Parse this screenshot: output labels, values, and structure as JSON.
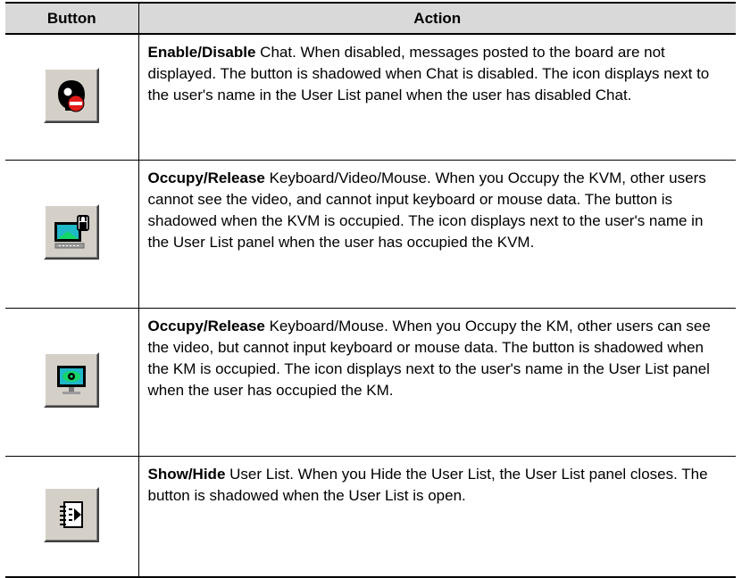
{
  "table": {
    "headers": {
      "button": "Button",
      "action": "Action"
    },
    "rows": [
      {
        "icon": "chat-disable-icon",
        "bold": "Enable/Disable",
        "text": " Chat. When disabled, messages posted to the board are not displayed. The button is shadowed when Chat is disabled. The icon displays next to the user's name in the User List panel when the user has disabled Chat."
      },
      {
        "icon": "occupy-kvm-icon",
        "bold": "Occupy/Release",
        "text": " Keyboard/Video/Mouse. When you Occupy the KVM, other users cannot see the video, and cannot input keyboard or mouse data. The button is shadowed when the KVM is occupied. The icon displays next to the user's name in the User List panel when the user has occupied the KVM."
      },
      {
        "icon": "occupy-km-icon",
        "bold": "Occupy/Release",
        "text": " Keyboard/Mouse. When you Occupy the KM, other users can see the video, but cannot input keyboard or mouse data. The button is shadowed when the KM is occupied. The icon displays next to the user's name in the User List panel when the user has occupied the KM."
      },
      {
        "icon": "user-list-icon",
        "bold": "Show/Hide",
        "text": " User List. When you Hide the User List, the User List panel closes. The button is shadowed when the User List is open."
      }
    ]
  }
}
